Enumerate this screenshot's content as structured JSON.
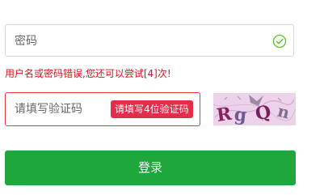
{
  "password_field": {
    "placeholder": "密码"
  },
  "error": {
    "message": "用户名或密码错误,您还可以尝试[4]次!"
  },
  "captcha_field": {
    "placeholder": "请填写验证码",
    "tip": "请填写4位验证码"
  },
  "captcha_image": {
    "chars": [
      "R",
      "g",
      "Q",
      "n"
    ],
    "colors": [
      "#8a2060",
      "#6d5b8f",
      "#7a1f5c",
      "#7d6e95"
    ]
  },
  "login_button": {
    "label": "登录",
    "color": "#1ea73d"
  },
  "colors": {
    "error_text": "#e4101b",
    "valid_check": "#52c41a",
    "captcha_tip_bg": "#e32e4b",
    "captcha_border": "#e4393c"
  }
}
